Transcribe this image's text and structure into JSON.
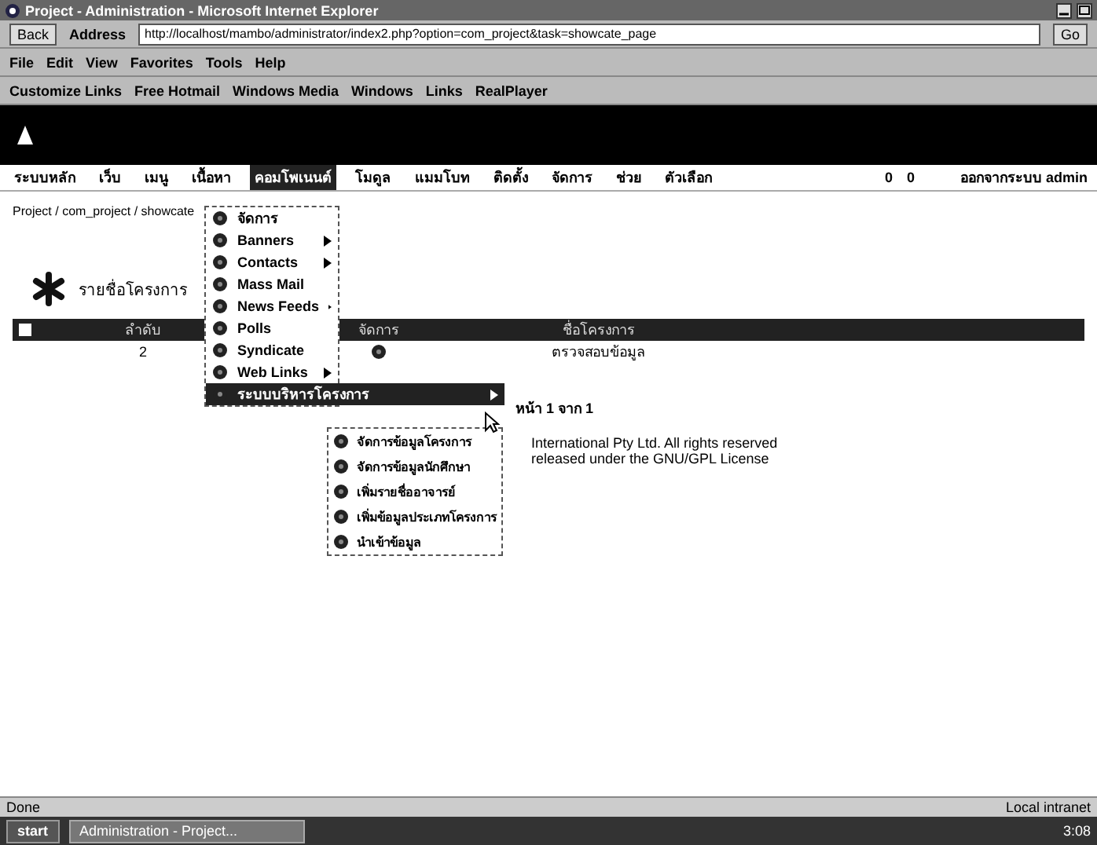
{
  "window": {
    "title": "Project - Administration - Microsoft Internet Explorer"
  },
  "browser": {
    "back_label": "Back",
    "address_label": "Address",
    "address": "http://localhost/mambo/administrator/index2.php?option=com_project&task=showcate_page",
    "go_label": "Go",
    "menu": [
      "File",
      "Edit",
      "View",
      "Favorites",
      "Tools",
      "Help"
    ],
    "links": [
      "Customize Links",
      "Free Hotmail",
      "Windows Media",
      "Windows",
      "Links",
      "RealPlayer"
    ]
  },
  "nav": {
    "items": [
      {
        "label": "ระบบหลัก",
        "selected": false
      },
      {
        "label": "เว็บ",
        "selected": false
      },
      {
        "label": "เมนู",
        "selected": false
      },
      {
        "label": "เนื้อหา",
        "selected": false
      },
      {
        "label": "คอมโพเนนต์",
        "selected": true
      },
      {
        "label": "โมดูล",
        "selected": false
      },
      {
        "label": "แมมโบท",
        "selected": false
      },
      {
        "label": "ติดตั้ง",
        "selected": false
      },
      {
        "label": "จัดการ",
        "selected": false
      },
      {
        "label": "ช่วย",
        "selected": false
      },
      {
        "label": "ตัวเลือก",
        "selected": false
      }
    ],
    "counts": [
      "0",
      "0"
    ],
    "user_label": "ออกจากระบบ admin"
  },
  "breadcrumb": "Project / com_project / showcate",
  "page_title": "รายชื่อโครงการ",
  "table": {
    "all_checked": false,
    "columns": [
      "ลำดับ",
      "จัดการ",
      "ชื่อโครงการ"
    ],
    "rows": [
      [
        "2",
        "",
        "ตรวจสอบข้อมูล"
      ]
    ]
  },
  "pagination": "หน้า 1 จาก 1",
  "footer": [
    "International Pty Ltd. All rights reserved",
    "released under the GNU/GPL License"
  ],
  "dropdown": {
    "items": [
      {
        "label": "จัดการ",
        "submenu": false,
        "selected": false
      },
      {
        "label": "Banners",
        "submenu": true,
        "selected": false
      },
      {
        "label": "Contacts",
        "submenu": true,
        "selected": false
      },
      {
        "label": "Mass Mail",
        "submenu": false,
        "selected": false
      },
      {
        "label": "News Feeds",
        "submenu": true,
        "selected": false
      },
      {
        "label": "Polls",
        "submenu": false,
        "selected": false
      },
      {
        "label": "Syndicate",
        "submenu": false,
        "selected": false
      },
      {
        "label": "Web Links",
        "submenu": true,
        "selected": false
      },
      {
        "label": "ระบบบริหารโครงการ",
        "submenu": true,
        "selected": true
      }
    ],
    "submenu": [
      "จัดการข้อมูลโครงการ",
      "จัดการข้อมูลนักศึกษา",
      "เพิ่มรายชื่ออาจารย์",
      "เพิ่มข้อมูลประเภทโครงการ",
      "นำเข้าข้อมูล"
    ]
  },
  "status_bar": {
    "left": "Done",
    "right": "Local intranet"
  },
  "taskbar": {
    "start": "start",
    "tasks": [
      "Administration - Project..."
    ],
    "clock": "3:08"
  }
}
